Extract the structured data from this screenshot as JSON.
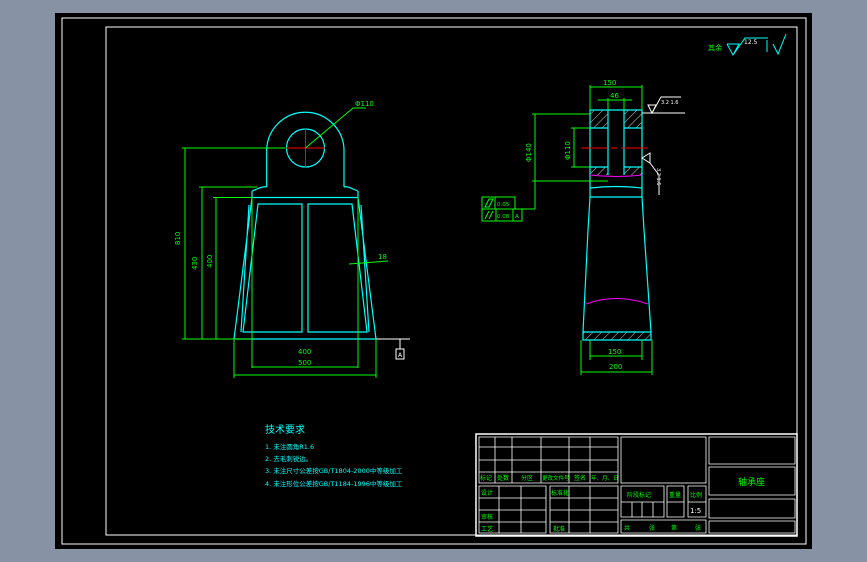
{
  "colors": {
    "background": "#8793a4",
    "sheet": "#000000",
    "outline": "#00ffff",
    "dimension": "#00ff00",
    "centerline": "#ff0000",
    "hidden": "#ff00ff",
    "frame": "#ffffff"
  },
  "surface_finish": {
    "label": "其余",
    "value": "12.5"
  },
  "front_view": {
    "hole_dim": "Φ110",
    "dim_height_total": "810",
    "dim_height_mid": "430",
    "dim_height_body": "400",
    "dim_width_inner": "400",
    "dim_width_outer": "500",
    "dim_wall": "18",
    "datum": "A"
  },
  "side_view": {
    "dim_top_width": "150",
    "dim_slot": "46",
    "dim_outer_dia": "Φ140",
    "dim_inner_dia": "Φ110",
    "dim_bottom_inner": "150",
    "dim_bottom_outer": "200",
    "finish_top": "3.2  1.6",
    "finish_side": "3.2  1.6",
    "tol1": "0.05",
    "tol2": "0.08",
    "tol2_datum": "A"
  },
  "tech_requirements": {
    "title": "技术要求",
    "items": [
      "1. 未注圆角R1.6",
      "2. 去毛刺锐边。",
      "3. 未注尺寸公差按GB/T1804-2000中等级加工",
      "4. 未注形位公差按GB/T1184-1996中等级加工"
    ]
  },
  "title_block": {
    "header": [
      "标记",
      "处数",
      "分区",
      "更改文件号",
      "签名",
      "年、月、日"
    ],
    "design": "设计",
    "standardize": "标准化",
    "review": "审核",
    "process": "工艺",
    "approve": "批准",
    "stage_mark": "阶段标记",
    "weight": "重量",
    "scale_label": "比例",
    "scale": "1:5",
    "sheets": [
      "共",
      "张",
      "第",
      "张"
    ],
    "part_name": "轴承座"
  }
}
